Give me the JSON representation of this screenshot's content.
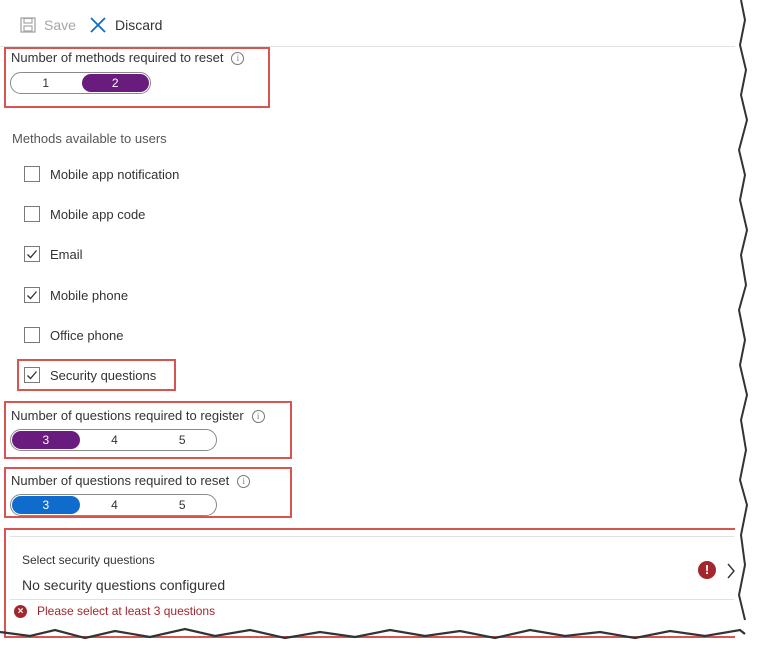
{
  "toolbar": {
    "save_label": "Save",
    "discard_label": "Discard",
    "save_icon": "floppy-disk-icon",
    "discard_icon": "close-x-icon"
  },
  "methods_required": {
    "label": "Number of methods required to reset",
    "options": [
      "1",
      "2"
    ],
    "selected": "2"
  },
  "methods_caption": "Methods available to users",
  "methods": [
    {
      "label": "Mobile app notification",
      "checked": false
    },
    {
      "label": "Mobile app code",
      "checked": false
    },
    {
      "label": "Email",
      "checked": true
    },
    {
      "label": "Mobile phone",
      "checked": true
    },
    {
      "label": "Office phone",
      "checked": false
    },
    {
      "label": "Security questions",
      "checked": true
    }
  ],
  "questions_register": {
    "label": "Number of questions required to register",
    "options": [
      "3",
      "4",
      "5"
    ],
    "selected": "3"
  },
  "questions_reset": {
    "label": "Number of questions required to reset",
    "options": [
      "3",
      "4",
      "5"
    ],
    "selected": "3"
  },
  "security_questions": {
    "title": "Select security questions",
    "value": "No security questions configured",
    "alert_icon": "!",
    "error": "Please select at least 3 questions",
    "error_icon": "×"
  },
  "colors": {
    "purple": "#6a1b7e",
    "blue": "#0f6ccc",
    "error_red": "#a4262c",
    "highlight_red": "#d9534f"
  }
}
